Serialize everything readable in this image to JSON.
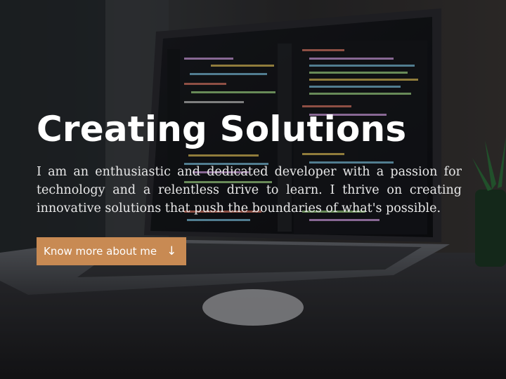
{
  "hero": {
    "title": "Creating Solutions",
    "description": "I am an enthusiastic and dedicated developer with a passion for technology and a relentless drive to learn. I thrive on creating innovative solutions that push the boundaries of what's possible.",
    "cta_label": "Know more about me",
    "cta_icon": "arrow-down-icon",
    "cta_arrow_glyph": "↓"
  },
  "colors": {
    "accent": "#c88a53",
    "text": "#ffffff",
    "overlay": "rgba(0,0,0,0.30)"
  },
  "background": {
    "scene": "laptop-with-code-editor-on-desk"
  }
}
